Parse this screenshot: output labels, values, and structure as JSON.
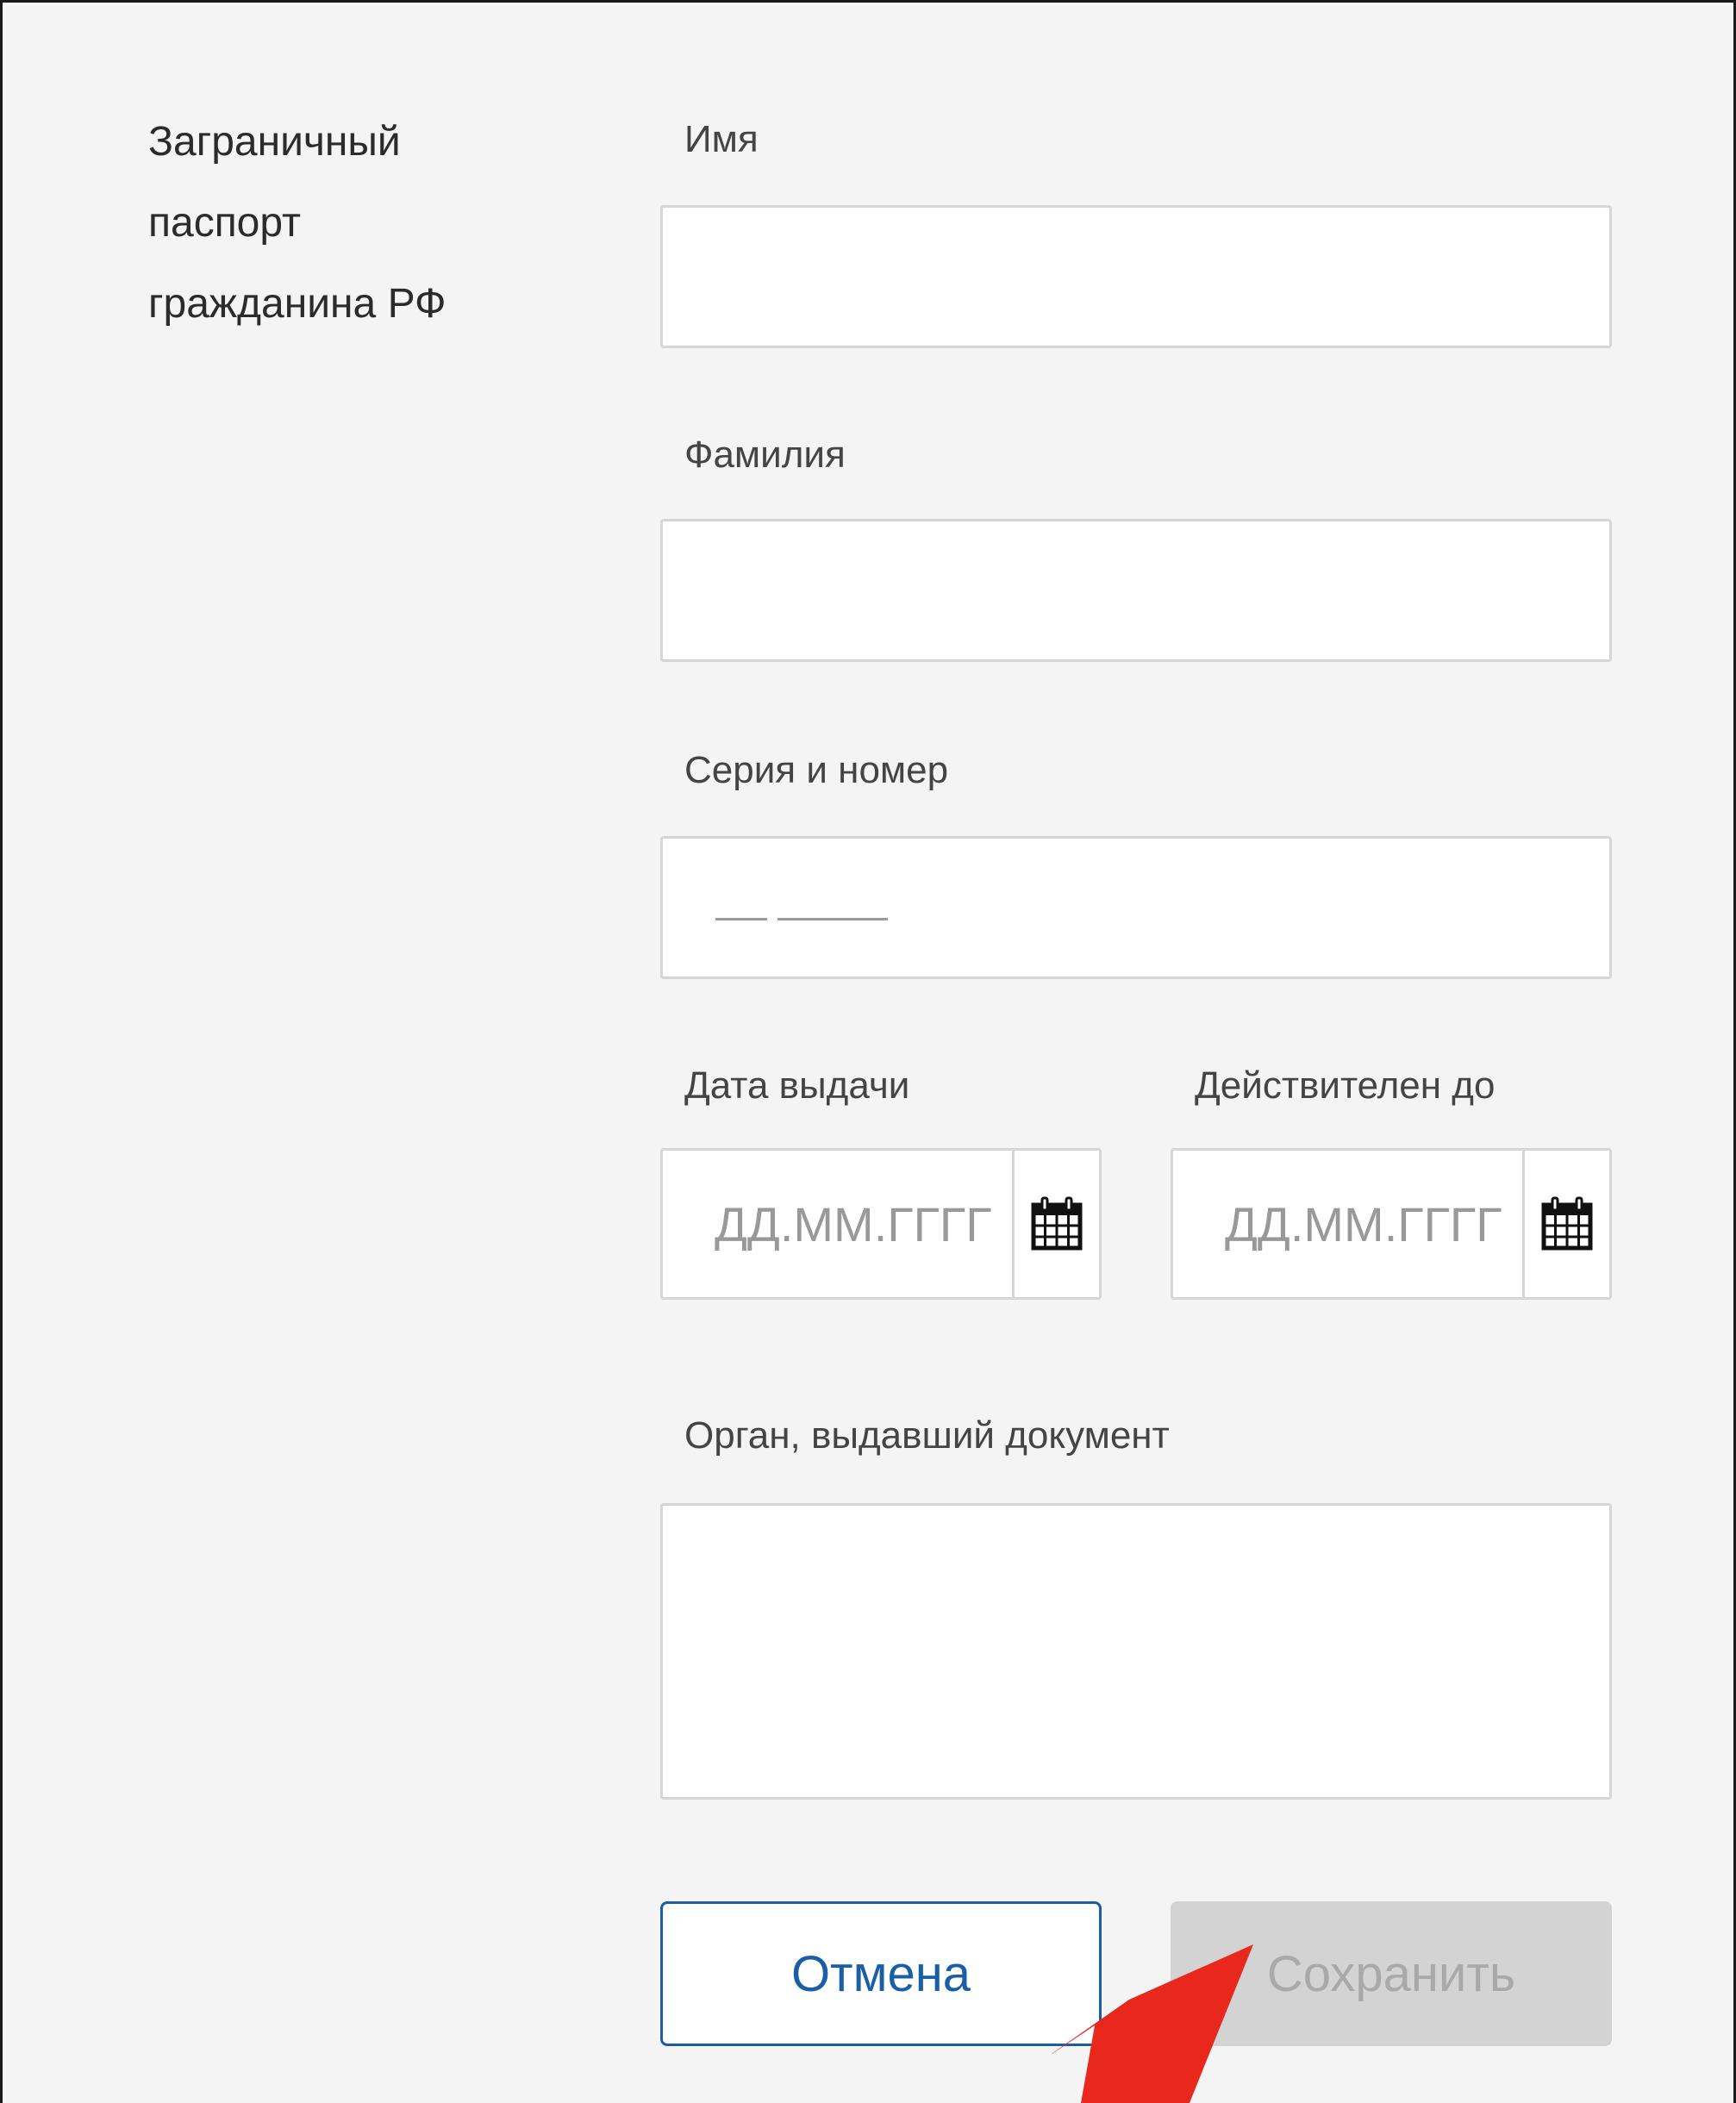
{
  "section": {
    "title_lines": [
      "Заграничный",
      "паспорт",
      "гражданина РФ"
    ]
  },
  "form": {
    "first_name": {
      "label": "Имя",
      "value": ""
    },
    "last_name": {
      "label": "Фамилия",
      "value": ""
    },
    "series_number": {
      "label": "Серия и номер",
      "value": ""
    },
    "issue_date": {
      "label": "Дата выдачи",
      "placeholder": "ДД.ММ.ГГГГ"
    },
    "valid_until": {
      "label": "Действителен до",
      "placeholder": "ДД.ММ.ГГГГ"
    },
    "issuing_authority": {
      "label": "Орган, выдавший документ",
      "value": ""
    }
  },
  "buttons": {
    "cancel_label": "Отмена",
    "save_label": "Сохранить"
  },
  "colors": {
    "accent": "#1a5ea8",
    "disabled_bg": "#d3d3d3",
    "disabled_text": "#a9a9a9",
    "annotation_arrow": "#e8281c"
  },
  "icons": {
    "date_picker": "calendar-icon",
    "annotation": "red-arrow-pointer-icon"
  }
}
